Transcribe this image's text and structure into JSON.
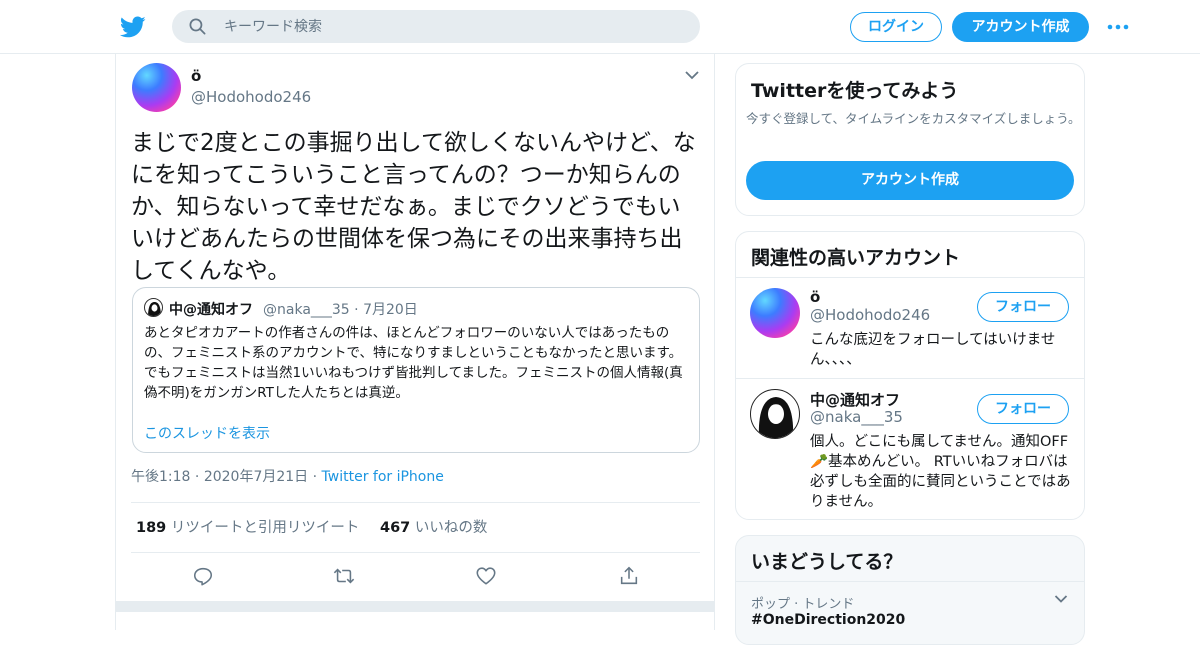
{
  "header": {
    "search_placeholder": "キーワード検索",
    "login_label": "ログイン",
    "signup_label": "アカウント作成"
  },
  "tweet": {
    "name": "ö",
    "handle": "@Hodohodo246",
    "text": "まじで2度とこの事掘り出して欲しくないんやけど、なにを知ってこういうこと言ってんの？つーか知らんのか、知らないって幸せだなぁ。まじでクソどうでもいいけどあんたらの世間体を保つ為にその出来事持ち出してくんなや。",
    "quote": {
      "name": "中@通知オフ",
      "handle": "@naka___35",
      "date": "· 7月20日",
      "text_p1": "あとタピオカアートの作者さんの件は、ほとんどフォロワーのいない人ではあったものの、フェミニスト系のアカウントで、特になりすましということもなかったと思います。",
      "text_p2": "でもフェミニストは当然1いいねもつけず皆批判してました。フェミニストの個人情報(真偽不明)をガンガンRTした人たちとは真逆。",
      "thread_link": "このスレッドを表示"
    },
    "time": "午後1:18",
    "date": "2020年7月21日",
    "source": "Twitter for iPhone",
    "retweets_count": "189",
    "retweets_label": "リツイートと引用リツイート",
    "likes_count": "467",
    "likes_label": "いいねの数"
  },
  "sidebar": {
    "signup_card": {
      "title": "Twitterを使ってみよう",
      "desc": "今すぐ登録して、タイムラインをカスタマイズしましょう。",
      "button": "アカウント作成"
    },
    "related": {
      "title": "関連性の高いアカウント",
      "follow_label": "フォロー",
      "accounts": [
        {
          "name": "ö",
          "handle": "@Hodohodo246",
          "bio": "こんな底辺をフォローしてはいけません、、、、"
        },
        {
          "name": "中@通知オフ",
          "handle": "@naka___35",
          "bio": "個人。どこにも属してません。通知OFF🥕基本めんどい。 RTいいねフォロバは必ずしも全面的に賛同ということではありません。"
        }
      ]
    },
    "trends": {
      "title": "いまどうしてる？",
      "category": "ポップ · トレンド",
      "trend": "#OneDirection2020"
    }
  },
  "colors": {
    "accent": "#1da1f2",
    "link": "#1b95e0",
    "muted": "#657786",
    "border": "#e6ecf0"
  }
}
